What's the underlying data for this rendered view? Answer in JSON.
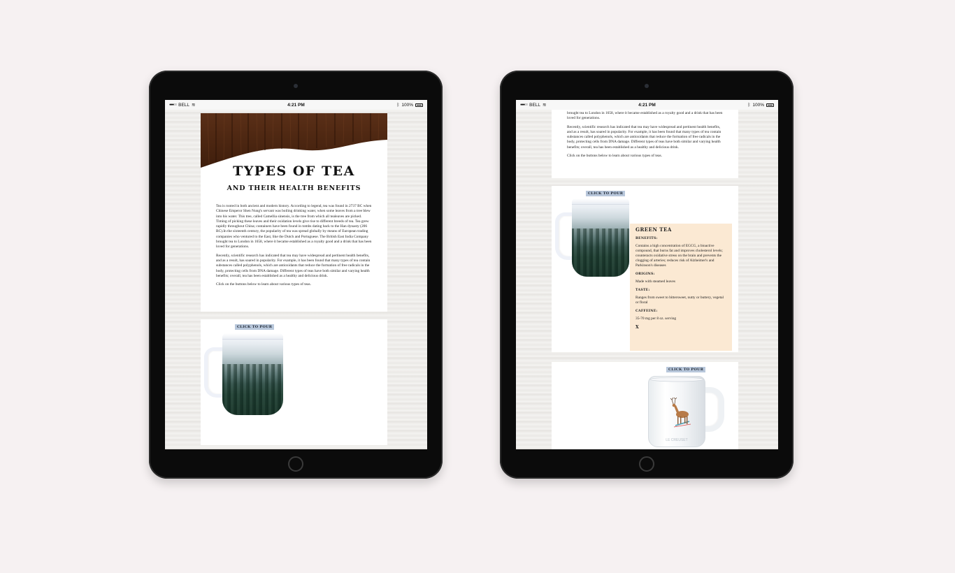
{
  "status": {
    "carrier": "BELL",
    "time": "4:21 PM",
    "battery": "100%"
  },
  "header": {
    "title": "TYPES OF TEA",
    "subtitle": "AND THEIR HEALTH BENEFITS"
  },
  "intro": {
    "p1": "Tea is rooted in both ancient and modern history. According to legend, tea was found in 2737 BC when Chinese Emperor Shen Nung's servant was boiling drinking water, when some leaves from a tree blew into his water. This tree, called Camellia sinensis, is the tree from which all tealeaves are picked. Timing of picking these leaves and their oxidation levels give rise to different breeds of tea. Tea grew rapidly throughout China; containers have been found in tombs dating back to the Han dynasty (206 BC).In the sixteenth century, the popularity of tea was spread globally by means of European trading companies who ventured to the East, like the Dutch and Portuguese. The British East India Company brought tea to London in 1658, where it became established as a royalty good and a drink that has been loved for generations.",
    "p2": "Recently, scientific research has indicated that tea may have widespread and pertinent health benefits, and as a result, has soared in popularity. For example, it has been found that many types of tea contain substances called polyphenols, which are antioxidants that reduce the formation of free radicals in the body, protecting cells from DNA damage. Different types of teas have both similar and varying health benefits; overall, tea has been established as a healthy and delicious drink.",
    "p3": "Click on the buttons below to learn about various types of teas.",
    "top_fragment": "brought tea to London in 1658, where it became established as a royalty good and a drink that has been loved for generations."
  },
  "buttons": {
    "pour": "CLICK TO POUR",
    "close": "X"
  },
  "green_tea": {
    "name": "GREEN TEA",
    "benefits_label": "BENEFITS:",
    "benefits": "Contains a high concentration of EGCG, a bioactive compound, that burns fat and improves cholesterol levels; counteracts oxidative stress on the brain and prevents the clogging of arteries; reduces risk of Alzheimer's and Parkinson's diseases",
    "origins_label": "ORIGINS:",
    "origins": "Made with steamed leaves",
    "taste_label": "TASTE:",
    "taste": "Ranges from sweet to bittersweet, nutty or buttery, vegetal or floral",
    "caffeine_label": "CAFFEINE:",
    "caffeine": "35-70 mg per 8 oz. serving"
  },
  "icons": [
    "signal-icon",
    "wifi-icon",
    "bluetooth-icon",
    "battery-icon",
    "camera-icon",
    "home-button-icon",
    "mug-icon",
    "deer-icon"
  ]
}
